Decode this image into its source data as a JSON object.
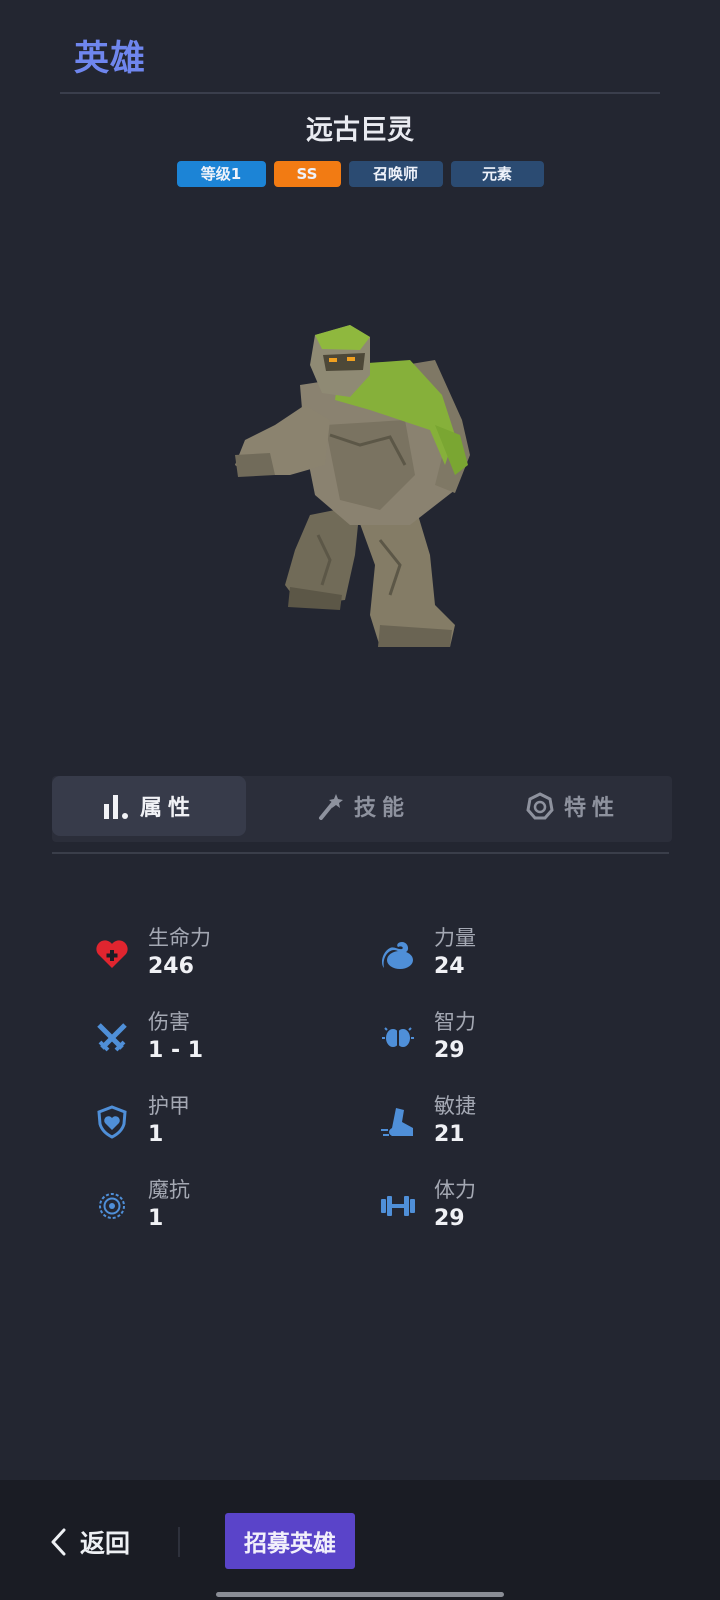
{
  "header": {
    "title": "英雄"
  },
  "hero": {
    "name": "远古巨灵",
    "tags": {
      "level": "等级1",
      "rank": "SS",
      "class": "召唤师",
      "type": "元素"
    }
  },
  "tabs": {
    "attributes": "属性",
    "skills": "技能",
    "traits": "特性",
    "active": "attributes"
  },
  "stats": {
    "health": {
      "label": "生命力",
      "value": "246",
      "icon": "heart-icon"
    },
    "strength": {
      "label": "力量",
      "value": "24",
      "icon": "bicep-icon"
    },
    "damage": {
      "label": "伤害",
      "value": "1 - 1",
      "icon": "crossed-swords-icon"
    },
    "intelligence": {
      "label": "智力",
      "value": "29",
      "icon": "brain-icon"
    },
    "armor": {
      "label": "护甲",
      "value": "1",
      "icon": "shield-icon"
    },
    "agility": {
      "label": "敏捷",
      "value": "21",
      "icon": "boot-icon"
    },
    "magic_resist": {
      "label": "魔抗",
      "value": "1",
      "icon": "spiral-icon"
    },
    "stamina": {
      "label": "体力",
      "value": "29",
      "icon": "dumbbell-icon"
    }
  },
  "footer": {
    "back_label": "返回",
    "recruit_label": "招募英雄"
  },
  "colors": {
    "background": "#232631",
    "title_accent": "#6f86ee",
    "level_tag": "#1c84d6",
    "rank_tag": "#f27b13",
    "category_tag": "#2b4b72",
    "recruit_button": "#5a44c9",
    "stat_icon": "#4f8fd8",
    "health_icon": "#e0252f"
  }
}
